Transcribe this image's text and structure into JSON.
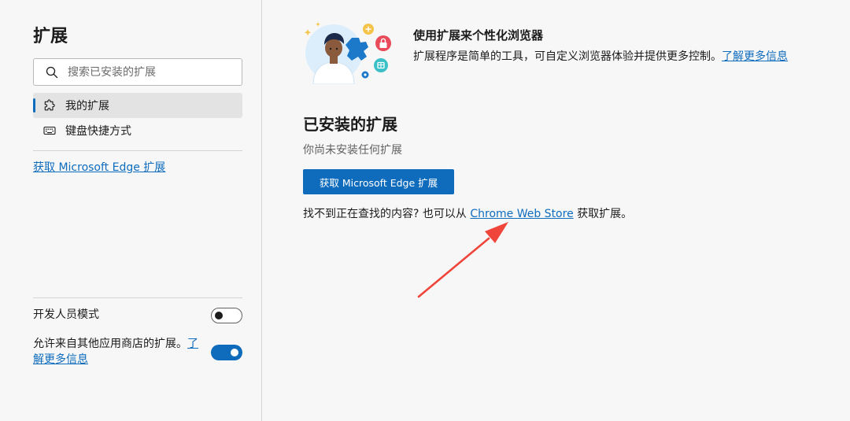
{
  "sidebar": {
    "title": "扩展",
    "search": {
      "placeholder": "搜索已安装的扩展",
      "value": ""
    },
    "nav": [
      {
        "label": "我的扩展",
        "icon": "puzzle-icon",
        "active": true
      },
      {
        "label": "键盘快捷方式",
        "icon": "keyboard-icon",
        "active": false
      }
    ],
    "get_link": "获取 Microsoft Edge 扩展",
    "dev_mode": {
      "label": "开发人员模式",
      "enabled": false
    },
    "allow_other": {
      "label": "允许来自其他应用商店的扩展。",
      "link1": "了",
      "link2": "解更多信息",
      "enabled": true
    }
  },
  "main": {
    "hero": {
      "title": "使用扩展来个性化浏览器",
      "desc": "扩展程序是简单的工具，可自定义浏览器体验并提供更多控制。",
      "learn_more": "了解更多信息"
    },
    "installed_title": "已安装的扩展",
    "empty_text": "你尚未安装任何扩展",
    "get_button": "获取 Microsoft Edge 扩展",
    "hint_prefix": "找不到正在查找的内容? 也可以从 ",
    "hint_link": "Chrome Web Store",
    "hint_suffix": " 获取扩展。"
  },
  "colors": {
    "accent": "#0f6cbd",
    "annotation_arrow": "#f0453a",
    "background": "#f7f7f7"
  }
}
